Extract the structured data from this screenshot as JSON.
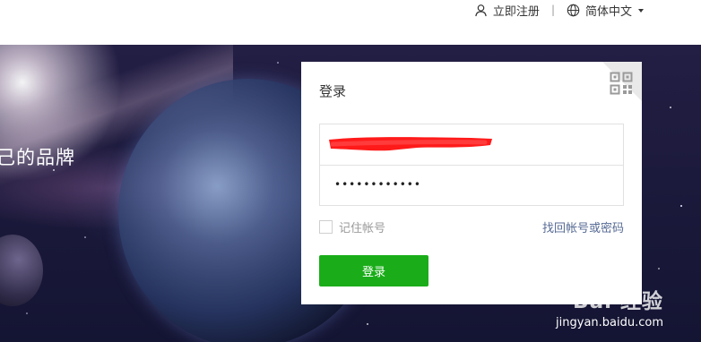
{
  "header": {
    "register_label": "立即注册",
    "separator": "|",
    "language_label": "简体中文",
    "icons": {
      "register": "user-icon",
      "language": "globe-icon",
      "dropdown": "caret-down-icon"
    }
  },
  "hero": {
    "slogan": "己的品牌"
  },
  "login": {
    "title": "登录",
    "qr_icon": "qr-code-icon",
    "account_value": "redacted (red marker over text)",
    "password_value": "••••••••••••",
    "remember_label": "记住帐号",
    "remember_checked": false,
    "forgot_label": "找回帐号或密码",
    "submit_label": "登录"
  },
  "watermark": {
    "logo": "Bai 经验",
    "url": "jingyan.baidu.com"
  },
  "colors": {
    "accent_green": "#1aad19",
    "link_blue": "#576b95",
    "muted_text": "#9a9a9a",
    "redaction_red": "#ff1a1a"
  }
}
